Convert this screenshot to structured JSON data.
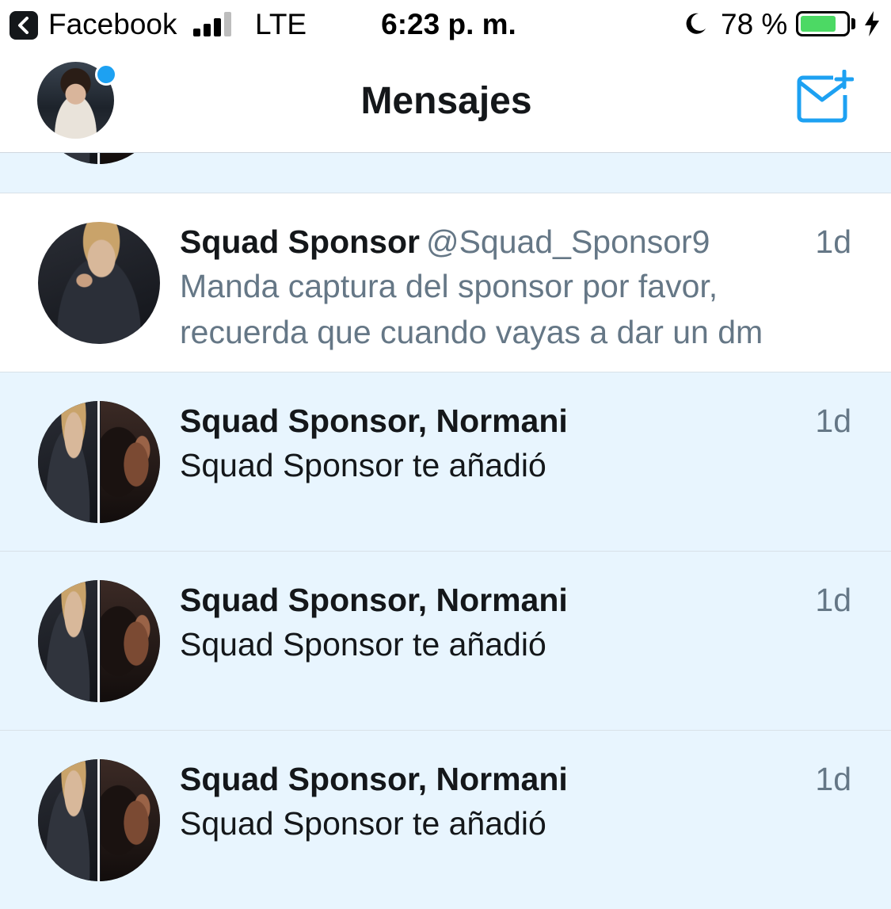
{
  "status_bar": {
    "back_app": "Facebook",
    "network": "LTE",
    "time": "6:23 p. m.",
    "battery_percent_label": "78 %",
    "battery_level": 0.78,
    "battery_color": "#4cd964",
    "icons": [
      "back-chevron-icon",
      "signal-icon",
      "moon-icon",
      "battery-icon",
      "charging-bolt-icon"
    ]
  },
  "header": {
    "title": "Mensajes",
    "compose_icon": "compose-message-icon",
    "accent_color": "#1da1f2"
  },
  "conversations": [
    {
      "name": "Squad Sponsor",
      "handle": "@Squad_Sponsor9",
      "time": "1d",
      "preview": "Manda captura del sponsor por favor, recuerda que cuando vayas a dar un dm",
      "unread": false
    },
    {
      "name": "Squad Sponsor, Normani",
      "handle": "",
      "time": "1d",
      "preview": "Squad Sponsor te añadió",
      "unread": true
    },
    {
      "name": "Squad Sponsor, Normani",
      "handle": "",
      "time": "1d",
      "preview": "Squad Sponsor te añadió",
      "unread": true
    },
    {
      "name": "Squad Sponsor, Normani",
      "handle": "",
      "time": "1d",
      "preview": "Squad Sponsor te añadió",
      "unread": true
    }
  ]
}
